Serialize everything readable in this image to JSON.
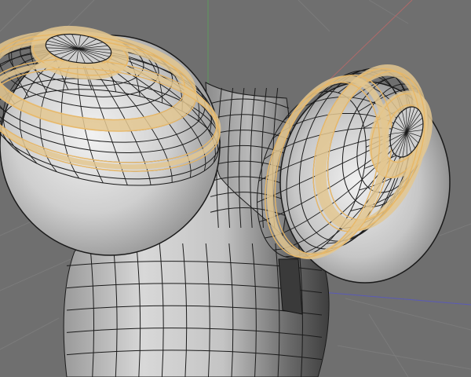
{
  "viewport": {
    "background": "#6f6f6f",
    "grid_color": "#7a7a7a",
    "axis_colors": {
      "x": "#b06a6a",
      "y": "#5e9a5e",
      "z": "#5a5ab8"
    }
  },
  "mesh": {
    "object": "polygon-mesh",
    "base_color": "#c9c9c9",
    "edge_color": "#1a1a1a",
    "selected_edge_color": "#e8b868",
    "selected_face_color": "#e3c790",
    "selection_mode": "edge-loops"
  }
}
